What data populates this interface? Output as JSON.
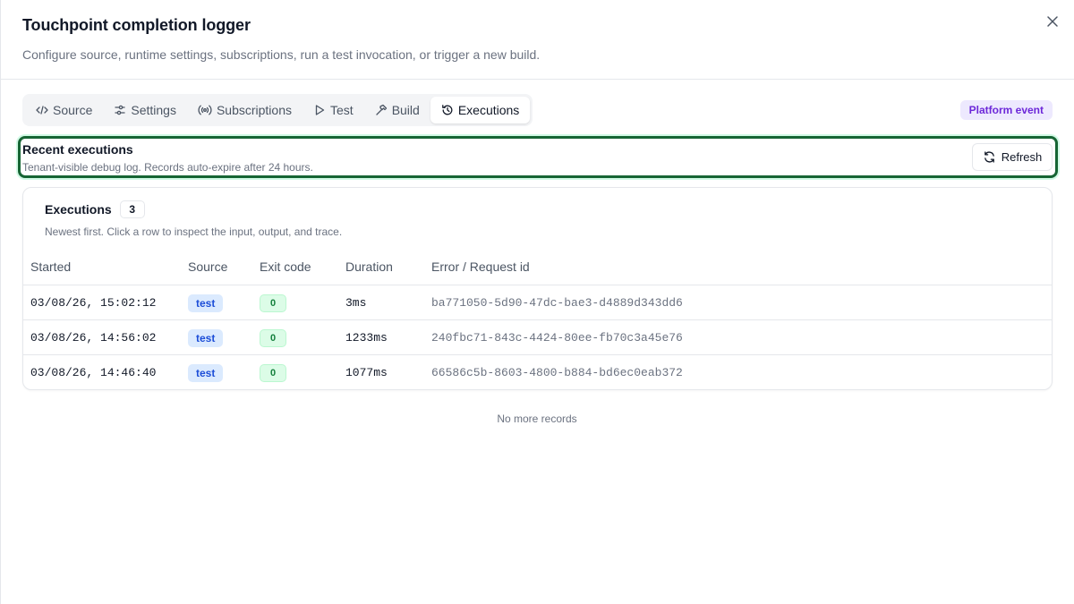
{
  "header": {
    "title": "Touchpoint completion logger",
    "subtitle": "Configure source, runtime settings, subscriptions, run a test invocation, or trigger a new build."
  },
  "tabs": [
    {
      "label": "Source",
      "icon": "code-icon",
      "active": false
    },
    {
      "label": "Settings",
      "icon": "sliders-icon",
      "active": false
    },
    {
      "label": "Subscriptions",
      "icon": "broadcast-icon",
      "active": false
    },
    {
      "label": "Test",
      "icon": "play-icon",
      "active": false
    },
    {
      "label": "Build",
      "icon": "hammer-icon",
      "active": false
    },
    {
      "label": "Executions",
      "icon": "history-icon",
      "active": true
    }
  ],
  "platform_badge": "Platform event",
  "section": {
    "title": "Recent executions",
    "description": "Tenant-visible debug log. Records auto-expire after 24 hours.",
    "refresh_label": "Refresh"
  },
  "executions": {
    "title": "Executions",
    "count": "3",
    "description": "Newest first. Click a row to inspect the input, output, and trace.",
    "columns": [
      "Started",
      "Source",
      "Exit code",
      "Duration",
      "Error / Request id"
    ],
    "rows": [
      {
        "started": "03/08/26, 15:02:12",
        "source": "test",
        "exit_code": "0",
        "duration": "3ms",
        "request_id": "ba771050-5d90-47dc-bae3-d4889d343dd6"
      },
      {
        "started": "03/08/26, 14:56:02",
        "source": "test",
        "exit_code": "0",
        "duration": "1233ms",
        "request_id": "240fbc71-843c-4424-80ee-fb70c3a45e76"
      },
      {
        "started": "03/08/26, 14:46:40",
        "source": "test",
        "exit_code": "0",
        "duration": "1077ms",
        "request_id": "66586c5b-8603-4800-b884-bd6ec0eab372"
      }
    ],
    "footer": "No more records"
  },
  "colors": {
    "accent_highlight": "#166534",
    "platform_badge_bg": "#ede9fe",
    "platform_badge_fg": "#6d28d9",
    "source_badge_bg": "#dbeafe",
    "exit_badge_bg": "#dcfce7"
  }
}
